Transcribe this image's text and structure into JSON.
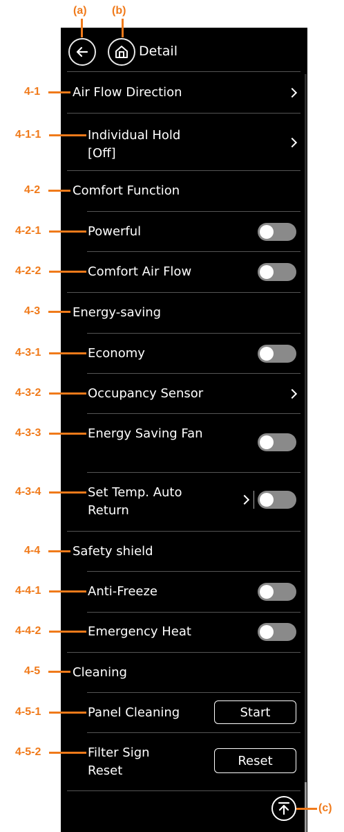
{
  "header": {
    "title": "Detail",
    "back_icon": "arrow-left-icon",
    "home_icon": "home-icon"
  },
  "rows": {
    "air_flow_direction": "Air Flow Direction",
    "individual_hold_line1": "Individual Hold",
    "individual_hold_line2": "[Off]",
    "comfort_function": "Comfort Function",
    "powerful": "Powerful",
    "comfort_air_flow": "Comfort Air Flow",
    "energy_saving": "Energy-saving",
    "economy": "Economy",
    "occupancy_sensor": "Occupancy Sensor",
    "energy_saving_fan": "Energy Saving Fan",
    "set_temp_line1": "Set Temp. Auto",
    "set_temp_line2": "Return",
    "safety_shield": "Safety shield",
    "anti_freeze": "Anti-Freeze",
    "emergency_heat": "Emergency Heat",
    "cleaning": "Cleaning",
    "panel_cleaning": "Panel Cleaning",
    "filter_sign_line1": "Filter Sign",
    "filter_sign_line2": "Reset"
  },
  "toggles": {
    "powerful": false,
    "comfort_air_flow": false,
    "economy": false,
    "energy_saving_fan": false,
    "set_temp_auto_return": false,
    "anti_freeze": false,
    "emergency_heat": false
  },
  "buttons": {
    "start": "Start",
    "reset": "Reset"
  },
  "annotations": {
    "a": "(a)",
    "b": "(b)",
    "c": "(c)",
    "n4_1": "4-1",
    "n4_1_1": "4-1-1",
    "n4_2": "4-2",
    "n4_2_1": "4-2-1",
    "n4_2_2": "4-2-2",
    "n4_3": "4-3",
    "n4_3_1": "4-3-1",
    "n4_3_2": "4-3-2",
    "n4_3_3": "4-3-3",
    "n4_3_4": "4-3-4",
    "n4_4": "4-4",
    "n4_4_1": "4-4-1",
    "n4_4_2": "4-4-2",
    "n4_5": "4-5",
    "n4_5_1": "4-5-1",
    "n4_5_2": "4-5-2"
  },
  "colors": {
    "annotation": "#f07a1a",
    "panel_bg": "#000000",
    "toggle_off": "#8a8a8a"
  },
  "scroll_top_icon": "scroll-to-top-icon"
}
